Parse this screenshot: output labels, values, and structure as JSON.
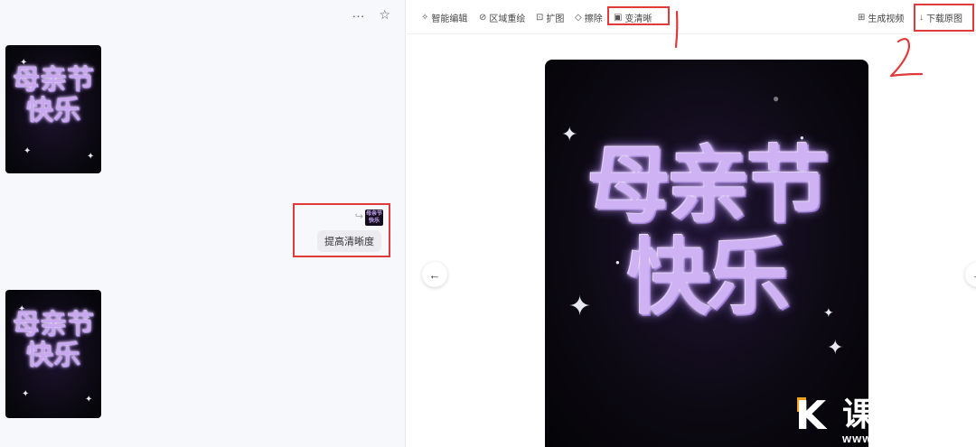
{
  "left": {
    "top_actions": [
      "···",
      "☆"
    ],
    "thumb_art_text": "母亲节\n快乐",
    "user_message": {
      "attachment_text": "母亲节快乐",
      "text": "提高清晰度"
    }
  },
  "toolbar": {
    "items": [
      {
        "icon": "✧",
        "label": "智能编辑"
      },
      {
        "icon": "⊘",
        "label": "区域重绘"
      },
      {
        "icon": "⊡",
        "label": "扩图"
      },
      {
        "icon": "◇",
        "label": "擦除"
      },
      {
        "icon": "▣",
        "label": "变清晰"
      }
    ],
    "right_items": [
      {
        "icon": "⊞",
        "label": "生成视频"
      },
      {
        "icon": "↓",
        "label": "下载原图"
      }
    ]
  },
  "annotations": {
    "mark1": "1",
    "mark2": "2"
  },
  "viewer": {
    "art_text": "母亲节\n快乐",
    "prev": "←",
    "next": "→"
  },
  "watermark": {
    "logo": "K",
    "name": "课多多",
    "url": "www.kedd.cn"
  },
  "colors": {
    "highlight": "#e03a3a",
    "art": "#cfb2f4",
    "bg_dark": "#0c0912"
  }
}
